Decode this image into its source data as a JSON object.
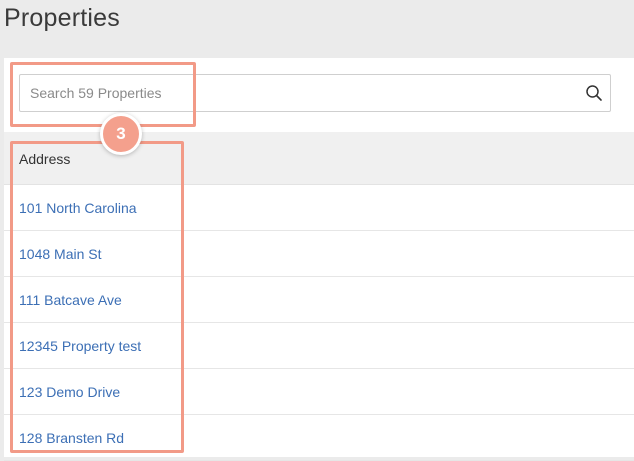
{
  "page": {
    "title": "Properties"
  },
  "search": {
    "placeholder": "Search 59 Properties",
    "value": "",
    "icon": "search-icon"
  },
  "table": {
    "columns": [
      "Address"
    ],
    "rows": [
      {
        "address": "101 North Carolina"
      },
      {
        "address": "1048 Main St"
      },
      {
        "address": "111 Batcave Ave"
      },
      {
        "address": "12345 Property test"
      },
      {
        "address": "123 Demo Drive"
      },
      {
        "address": "128 Bransten Rd"
      }
    ]
  },
  "annotation": {
    "step_number": "3",
    "color": "#f29a87"
  },
  "colors": {
    "link": "#3c6fb5",
    "header_bg": "#f0f0f0",
    "page_bg": "#ebebeb"
  }
}
